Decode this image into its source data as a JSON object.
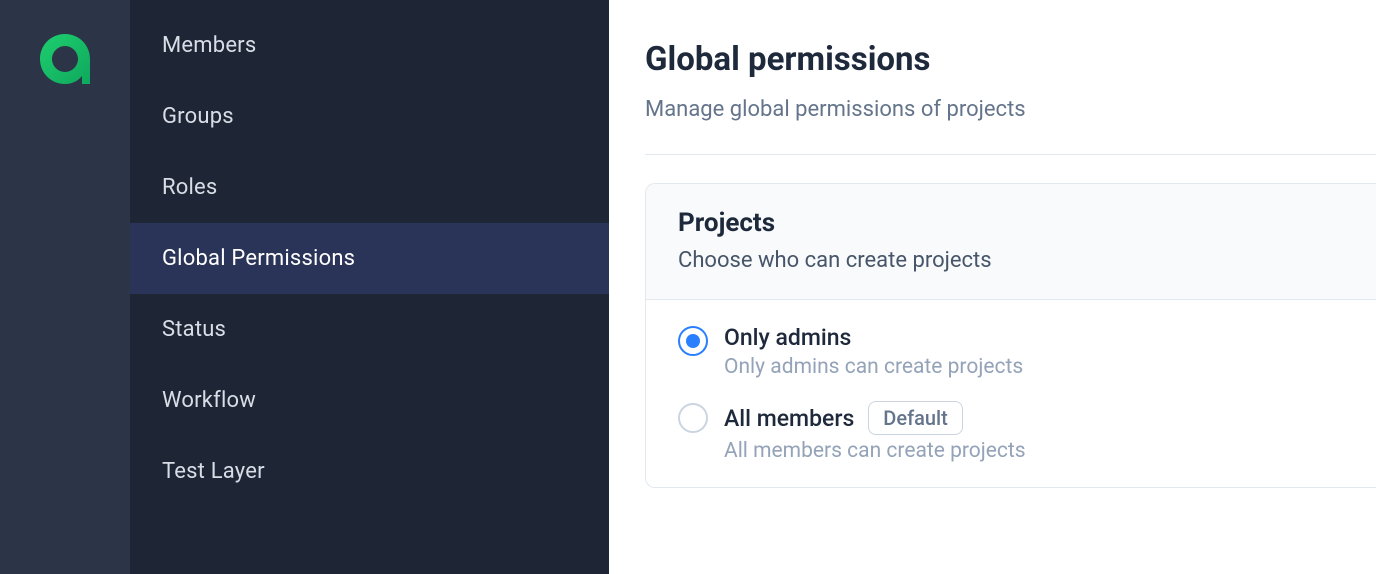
{
  "sidebar": {
    "items": [
      {
        "label": "Members",
        "active": false
      },
      {
        "label": "Groups",
        "active": false
      },
      {
        "label": "Roles",
        "active": false
      },
      {
        "label": "Global Permissions",
        "active": true
      },
      {
        "label": "Status",
        "active": false
      },
      {
        "label": "Workflow",
        "active": false
      },
      {
        "label": "Test Layer",
        "active": false
      }
    ]
  },
  "page": {
    "title": "Global permissions",
    "subtitle": "Manage global permissions of projects"
  },
  "card": {
    "title": "Projects",
    "subtitle": "Choose who can create projects",
    "options": [
      {
        "label": "Only admins",
        "description": "Only admins can create projects",
        "selected": true,
        "badge": null
      },
      {
        "label": "All members",
        "description": "All members can create projects",
        "selected": false,
        "badge": "Default"
      }
    ]
  }
}
